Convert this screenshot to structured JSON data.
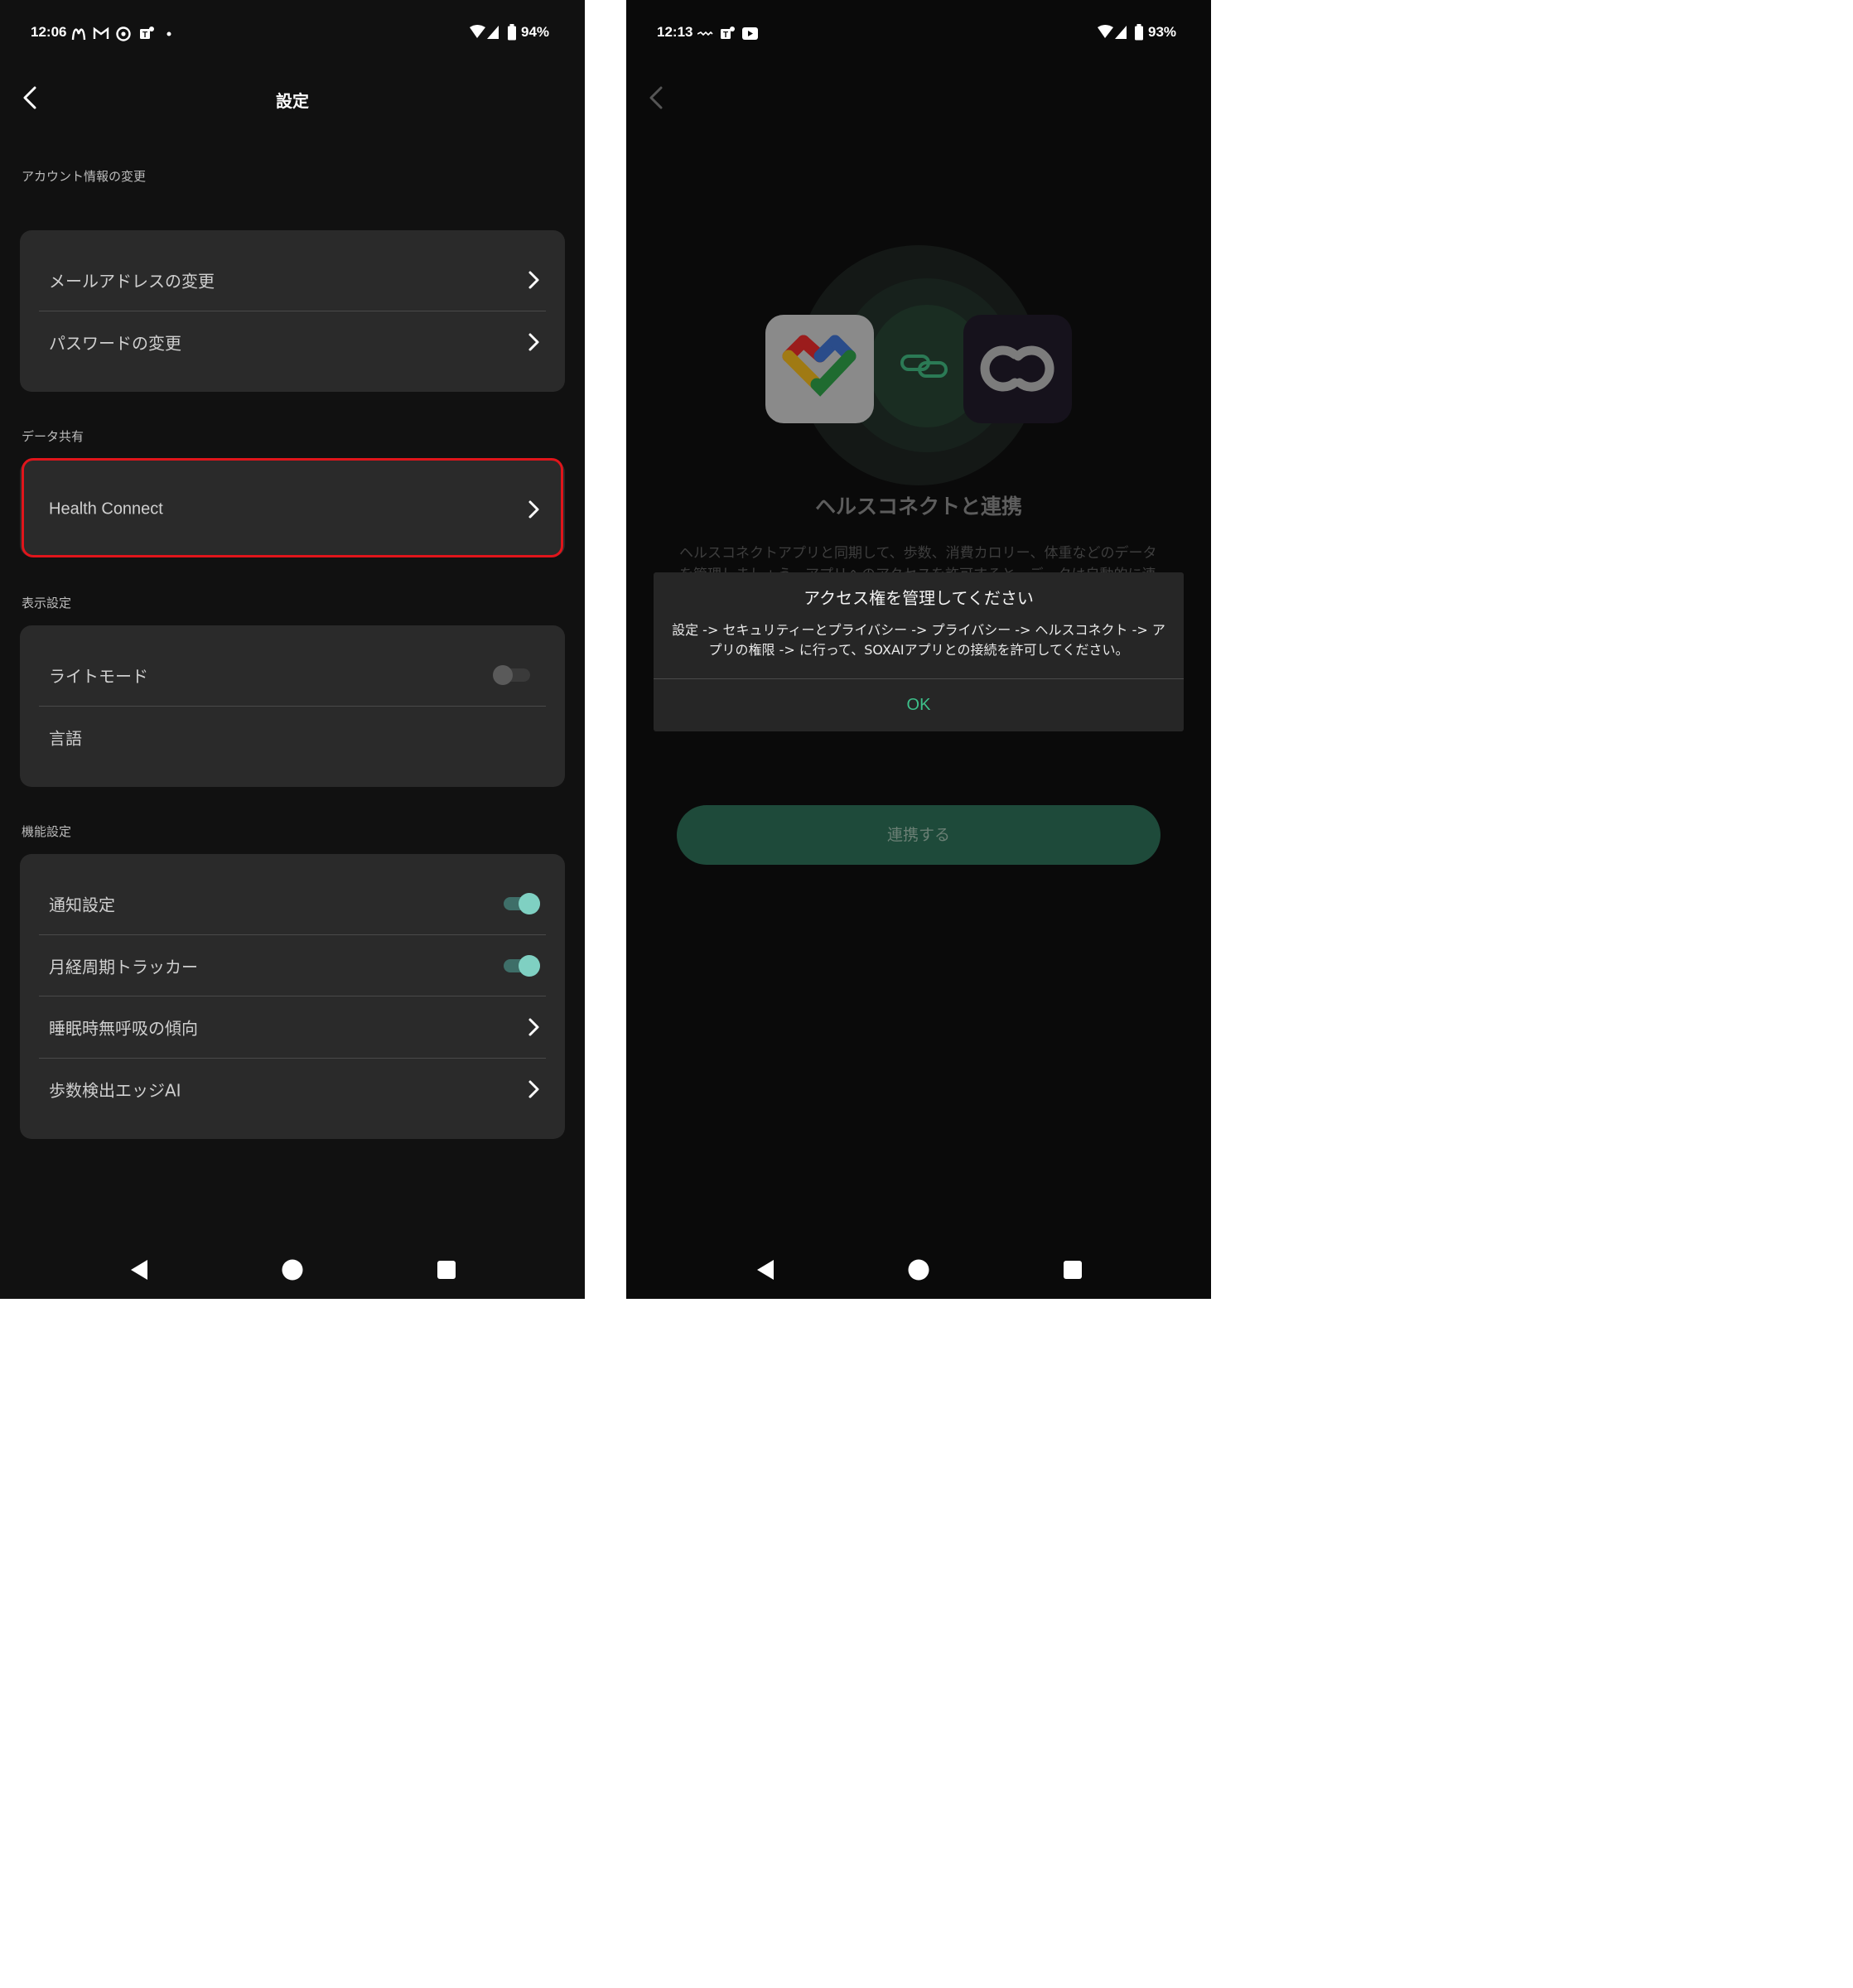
{
  "left": {
    "status": {
      "time": "12:06",
      "battery": "94%",
      "notif_icons": [
        "mcdonalds-icon",
        "gmail-icon",
        "chat-icon",
        "teams-icon",
        "dot-icon"
      ]
    },
    "header": {
      "title": "設定"
    },
    "sections": {
      "account": {
        "title": "アカウント情報の変更",
        "items": [
          "メールアドレスの変更",
          "パスワードの変更"
        ]
      },
      "data": {
        "title": "データ共有",
        "items": [
          "Health Connect"
        ]
      },
      "display": {
        "title": "表示設定",
        "items": [
          "ライトモード",
          "言語"
        ]
      },
      "function": {
        "title": "機能設定",
        "items": [
          "通知設定",
          "月経周期トラッカー",
          "睡眠時無呼吸の傾向",
          "歩数検出エッジAI"
        ]
      }
    },
    "toggles": {
      "light_mode": false,
      "notifications": true,
      "menstrual": true
    },
    "highlight_color": "#e0151b"
  },
  "right": {
    "status": {
      "time": "12:13",
      "battery": "93%",
      "notif_icons": [
        "app-icon",
        "teams-icon",
        "youtube-icon"
      ]
    },
    "hero": {
      "title": "ヘルスコネクトと連携",
      "description": "ヘルスコネクトアプリと同期して、歩数、消費カロリー、体重などのデータを管理しましょう。アプリへのアクセスを許可すると、データは自動的に連"
    },
    "dialog": {
      "title": "アクセス権を管理してください",
      "body": "設定 -> セキュリティーとプライバシー -> プライバシー -> ヘルスコネクト -> アプリの権限 -> に行って、SOXAIアプリとの接続を許可してください。",
      "ok": "OK"
    },
    "connect_button": "連携する",
    "accent": "#3dbf8a"
  }
}
